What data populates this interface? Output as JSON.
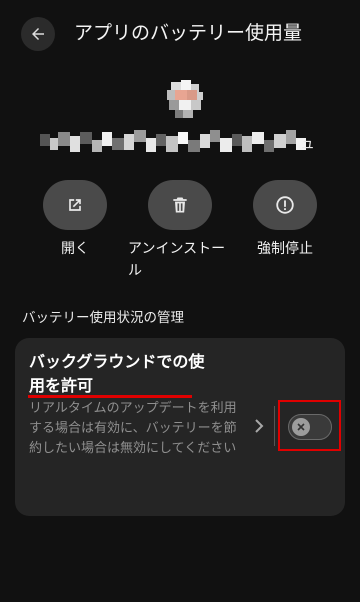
{
  "header": {
    "back_icon": "arrow-left-icon",
    "title": "アプリのバッテリー使用量"
  },
  "app": {
    "icon": "app-icon-pixelated",
    "name_visible_tail": "ュ"
  },
  "actions": [
    {
      "label": "開く",
      "icon": "open-external-icon"
    },
    {
      "label": "アンインストール",
      "icon": "trash-icon"
    },
    {
      "label": "強制停止",
      "icon": "alert-circle-icon"
    }
  ],
  "section": {
    "header": "バッテリー使用状況の管理"
  },
  "card": {
    "title": "バックグラウンドでの使用を許可",
    "description": "リアルタイムのアップデートを利用する場合は有効に、バッテリーを節約したい場合は無効にしてください",
    "toggle_state": "off",
    "toggle_icon": "x-icon",
    "chevron_icon": "chevron-right-icon"
  },
  "colors": {
    "background": "#111111",
    "button": "#4a4a4a",
    "card": "#252525",
    "annotation": "#e00000"
  }
}
